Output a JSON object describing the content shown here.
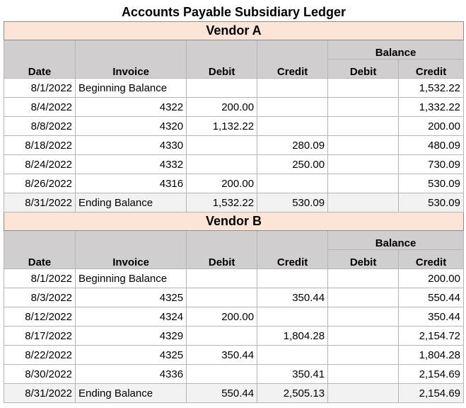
{
  "title": "Accounts Payable Subsidiary Ledger",
  "headers": {
    "date": "Date",
    "invoice": "Invoice",
    "debit": "Debit",
    "credit": "Credit",
    "balance": "Balance",
    "balance_debit": "Debit",
    "balance_credit": "Credit"
  },
  "vendors": [
    {
      "name": "Vendor A",
      "rows": [
        {
          "date": "8/1/2022",
          "invoice": "Beginning Balance",
          "debit": "",
          "credit": "",
          "bal_debit": "",
          "bal_credit": "1,532.22"
        },
        {
          "date": "8/4/2022",
          "invoice": "4322",
          "debit": "200.00",
          "credit": "",
          "bal_debit": "",
          "bal_credit": "1,332.22"
        },
        {
          "date": "8/8/2022",
          "invoice": "4320",
          "debit": "1,132.22",
          "credit": "",
          "bal_debit": "",
          "bal_credit": "200.00"
        },
        {
          "date": "8/18/2022",
          "invoice": "4330",
          "debit": "",
          "credit": "280.09",
          "bal_debit": "",
          "bal_credit": "480.09"
        },
        {
          "date": "8/24/2022",
          "invoice": "4332",
          "debit": "",
          "credit": "250.00",
          "bal_debit": "",
          "bal_credit": "730.09"
        },
        {
          "date": "8/26/2022",
          "invoice": "4316",
          "debit": "200.00",
          "credit": "",
          "bal_debit": "",
          "bal_credit": "530.09"
        }
      ],
      "ending": {
        "date": "8/31/2022",
        "invoice": "Ending Balance",
        "debit": "1,532.22",
        "credit": "530.09",
        "bal_debit": "",
        "bal_credit": "530.09"
      }
    },
    {
      "name": "Vendor B",
      "rows": [
        {
          "date": "8/1/2022",
          "invoice": "Beginning Balance",
          "debit": "",
          "credit": "",
          "bal_debit": "",
          "bal_credit": "200.00"
        },
        {
          "date": "8/3/2022",
          "invoice": "4325",
          "debit": "",
          "credit": "350.44",
          "bal_debit": "",
          "bal_credit": "550.44"
        },
        {
          "date": "8/12/2022",
          "invoice": "4324",
          "debit": "200.00",
          "credit": "",
          "bal_debit": "",
          "bal_credit": "350.44"
        },
        {
          "date": "8/17/2022",
          "invoice": "4329",
          "debit": "",
          "credit": "1,804.28",
          "bal_debit": "",
          "bal_credit": "2,154.72"
        },
        {
          "date": "8/22/2022",
          "invoice": "4325",
          "debit": "350.44",
          "credit": "",
          "bal_debit": "",
          "bal_credit": "1,804.28"
        },
        {
          "date": "8/30/2022",
          "invoice": "4336",
          "debit": "",
          "credit": "350.41",
          "bal_debit": "",
          "bal_credit": "2,154.69"
        }
      ],
      "ending": {
        "date": "8/31/2022",
        "invoice": "Ending Balance",
        "debit": "550.44",
        "credit": "2,505.13",
        "bal_debit": "",
        "bal_credit": "2,154.69"
      }
    }
  ]
}
